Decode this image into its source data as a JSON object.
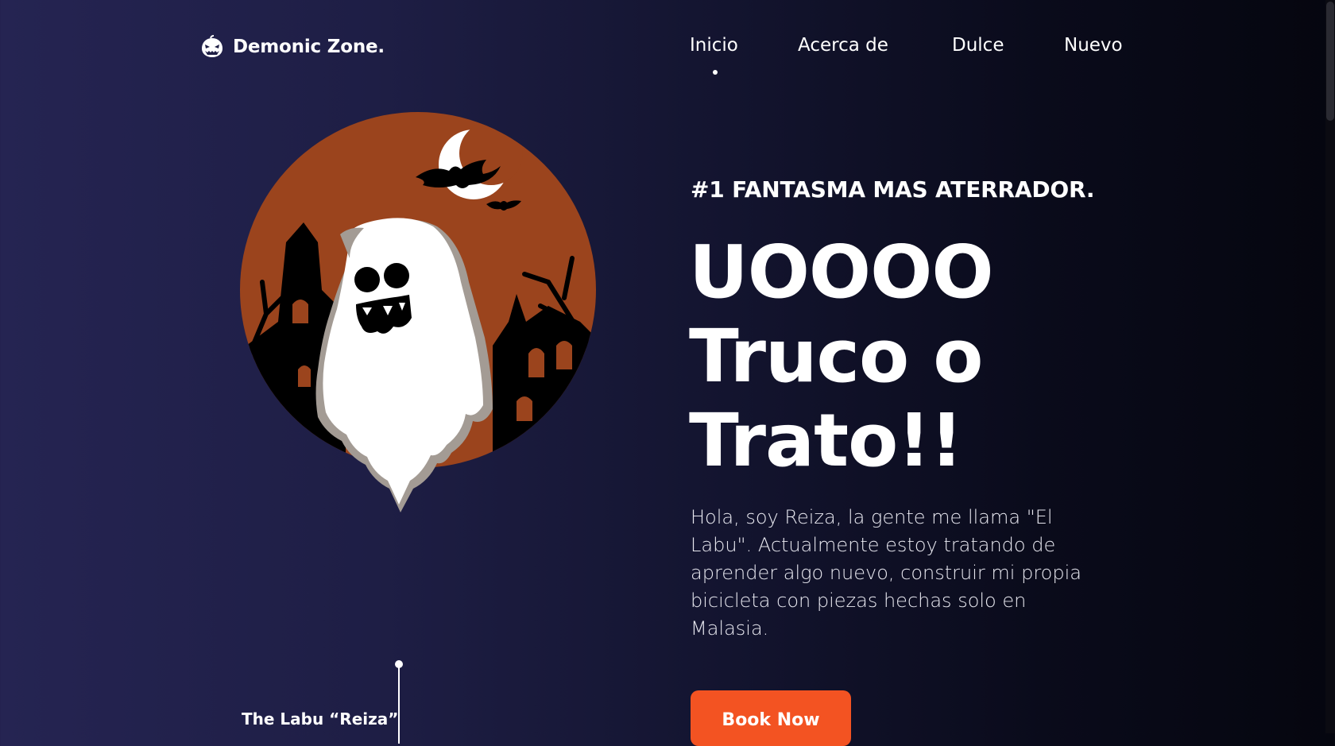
{
  "brand": {
    "name": "Demonic Zone.",
    "logo_icon": "pumpkin-face-icon"
  },
  "nav": {
    "items": [
      {
        "label": "Inicio",
        "active": true
      },
      {
        "label": "Acerca de",
        "active": false
      },
      {
        "label": "Dulce",
        "active": false
      },
      {
        "label": "Nuevo",
        "active": false
      }
    ]
  },
  "hero": {
    "eyebrow": "#1 FANTASMA MAS ATERRADOR.",
    "headline": [
      "UOOOO",
      "Truco o",
      "Trato!!"
    ],
    "intro": "Hola, soy Reiza, la gente me llama \"El Labu\". Actualmente estoy tratando de aprender algo nuevo, construir mi propia bicicleta con piezas hechas solo en Malasia.",
    "cta_label": "Book Now",
    "caption": "The Labu “Reiza”"
  },
  "colors": {
    "accent": "#f35322",
    "moon_circle": "#9b441d",
    "background_left": "#252452",
    "background_right": "#05060f"
  }
}
